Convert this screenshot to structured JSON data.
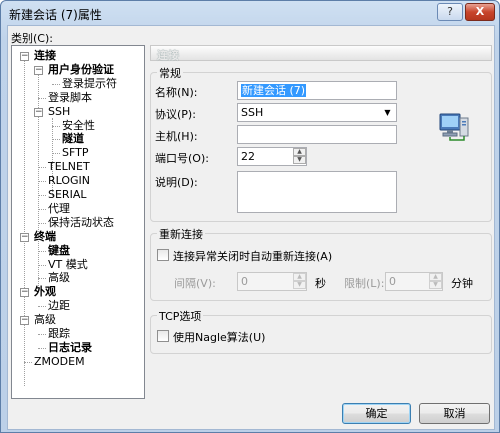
{
  "window": {
    "title": "新建会话 (7)属性",
    "help_btn": "?",
    "close_btn": "X"
  },
  "category_label": "类别(C):",
  "tree": [
    {
      "label": "连接",
      "bold": true,
      "expander": "−"
    },
    {
      "label": "用户身份验证",
      "bold": true,
      "expander": "−"
    },
    {
      "label": "登录提示符",
      "bold": false
    },
    {
      "label": "登录脚本",
      "bold": false
    },
    {
      "label": "SSH",
      "bold": false,
      "expander": "−"
    },
    {
      "label": "安全性",
      "bold": false
    },
    {
      "label": "隧道",
      "bold": true
    },
    {
      "label": "SFTP",
      "bold": false
    },
    {
      "label": "TELNET",
      "bold": false
    },
    {
      "label": "RLOGIN",
      "bold": false
    },
    {
      "label": "SERIAL",
      "bold": false
    },
    {
      "label": "代理",
      "bold": false
    },
    {
      "label": "保持活动状态",
      "bold": false
    },
    {
      "label": "终端",
      "bold": true,
      "expander": "−"
    },
    {
      "label": "键盘",
      "bold": true
    },
    {
      "label": "VT 模式",
      "bold": false
    },
    {
      "label": "高级",
      "bold": false
    },
    {
      "label": "外观",
      "bold": true,
      "expander": "−"
    },
    {
      "label": "边距",
      "bold": false
    },
    {
      "label": "高级",
      "bold": false,
      "expander": "−"
    },
    {
      "label": "跟踪",
      "bold": false
    },
    {
      "label": "日志记录",
      "bold": true
    },
    {
      "label": "ZMODEM",
      "bold": false
    }
  ],
  "section_header": "连接",
  "general": {
    "title": "常规",
    "name_label": "名称(N):",
    "name_value": "新建会话 (7)",
    "protocol_label": "协议(P):",
    "protocol_value": "SSH",
    "host_label": "主机(H):",
    "host_value": "",
    "port_label": "端口号(O):",
    "port_value": "22",
    "desc_label": "说明(D):",
    "desc_value": ""
  },
  "reconnect": {
    "title": "重新连接",
    "checkbox_label": "连接异常关闭时自动重新连接(A)",
    "interval_label": "间隔(V):",
    "interval_value": "0",
    "seconds_unit": "秒",
    "limit_label": "限制(L):",
    "limit_value": "0",
    "minutes_unit": "分钟"
  },
  "tcp": {
    "title": "TCP选项",
    "nagle_label": "使用Nagle算法(U)"
  },
  "buttons": {
    "ok": "确定",
    "cancel": "取消"
  },
  "icons": {
    "network": "network-computer-icon"
  },
  "colors": {
    "selection": "#3399ff",
    "title_bg": "#bfd3ea"
  }
}
